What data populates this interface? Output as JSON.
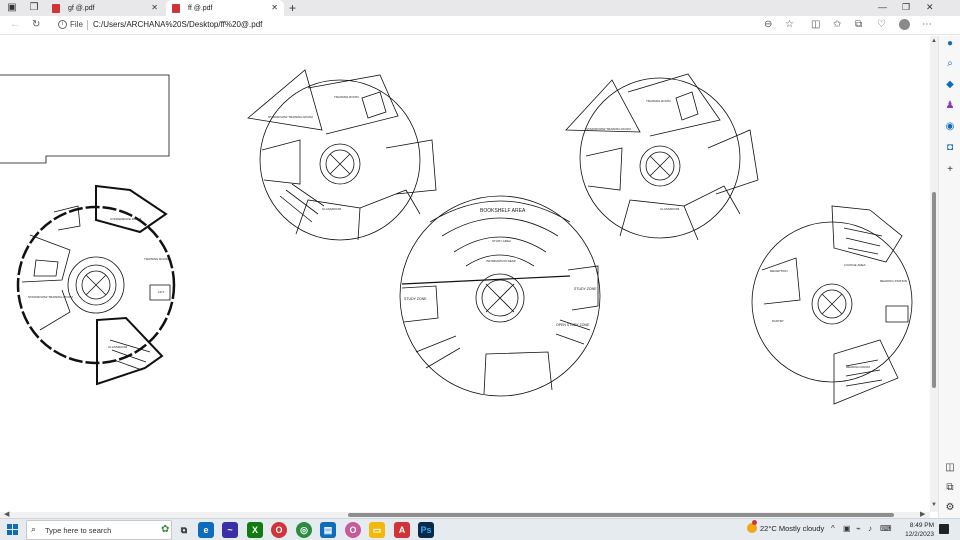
{
  "browser": {
    "tabs": [
      {
        "title": "gf @.pdf",
        "active": false
      },
      {
        "title": "ff @.pdf",
        "active": true
      }
    ],
    "address": {
      "scheme_label": "File",
      "url": "C:/Users/ARCHANA%20S/Desktop/ff%20@.pdf"
    }
  },
  "pdf": {
    "labels": {
      "bookshelf_area": "BOOKSHELF AREA",
      "study_zone_left": "STUDY ZONE",
      "study_zone_right": "STUDY ZONE",
      "open_study_zone": "OPEN STUDY ZONE",
      "information_desk": "INFORMATION DESK",
      "study_area": "STUDY AREA",
      "training_room": "TRAINING ROOM",
      "staffroom_training": "STAFFROOM/ TRAINING ROOM",
      "classroom": "CLASSROOM",
      "conference_room": "CONFERENCE ROOM",
      "lift": "LIFT",
      "reading_room": "READING ROOM",
      "pantry": "PANTRY",
      "reception": "RECEPTION",
      "lounge_area": "LOUNGE AREA",
      "seminar_room": "SEMINAR ROOM",
      "waiting_area": "WAITING AREA",
      "gaming_room": "GAMING ROOM",
      "reading_station": "READING STATION"
    }
  },
  "taskbar": {
    "search_placeholder": "Type here to search",
    "weather": "22°C  Mostly cloudy",
    "time": "8:49 PM",
    "date": "12/2/2023"
  },
  "colors": {
    "accent": "#0f6cbd",
    "pdf_red": "#d13438",
    "scroll_thumb": "#8e8e8e",
    "drawing_line": "#111111"
  }
}
